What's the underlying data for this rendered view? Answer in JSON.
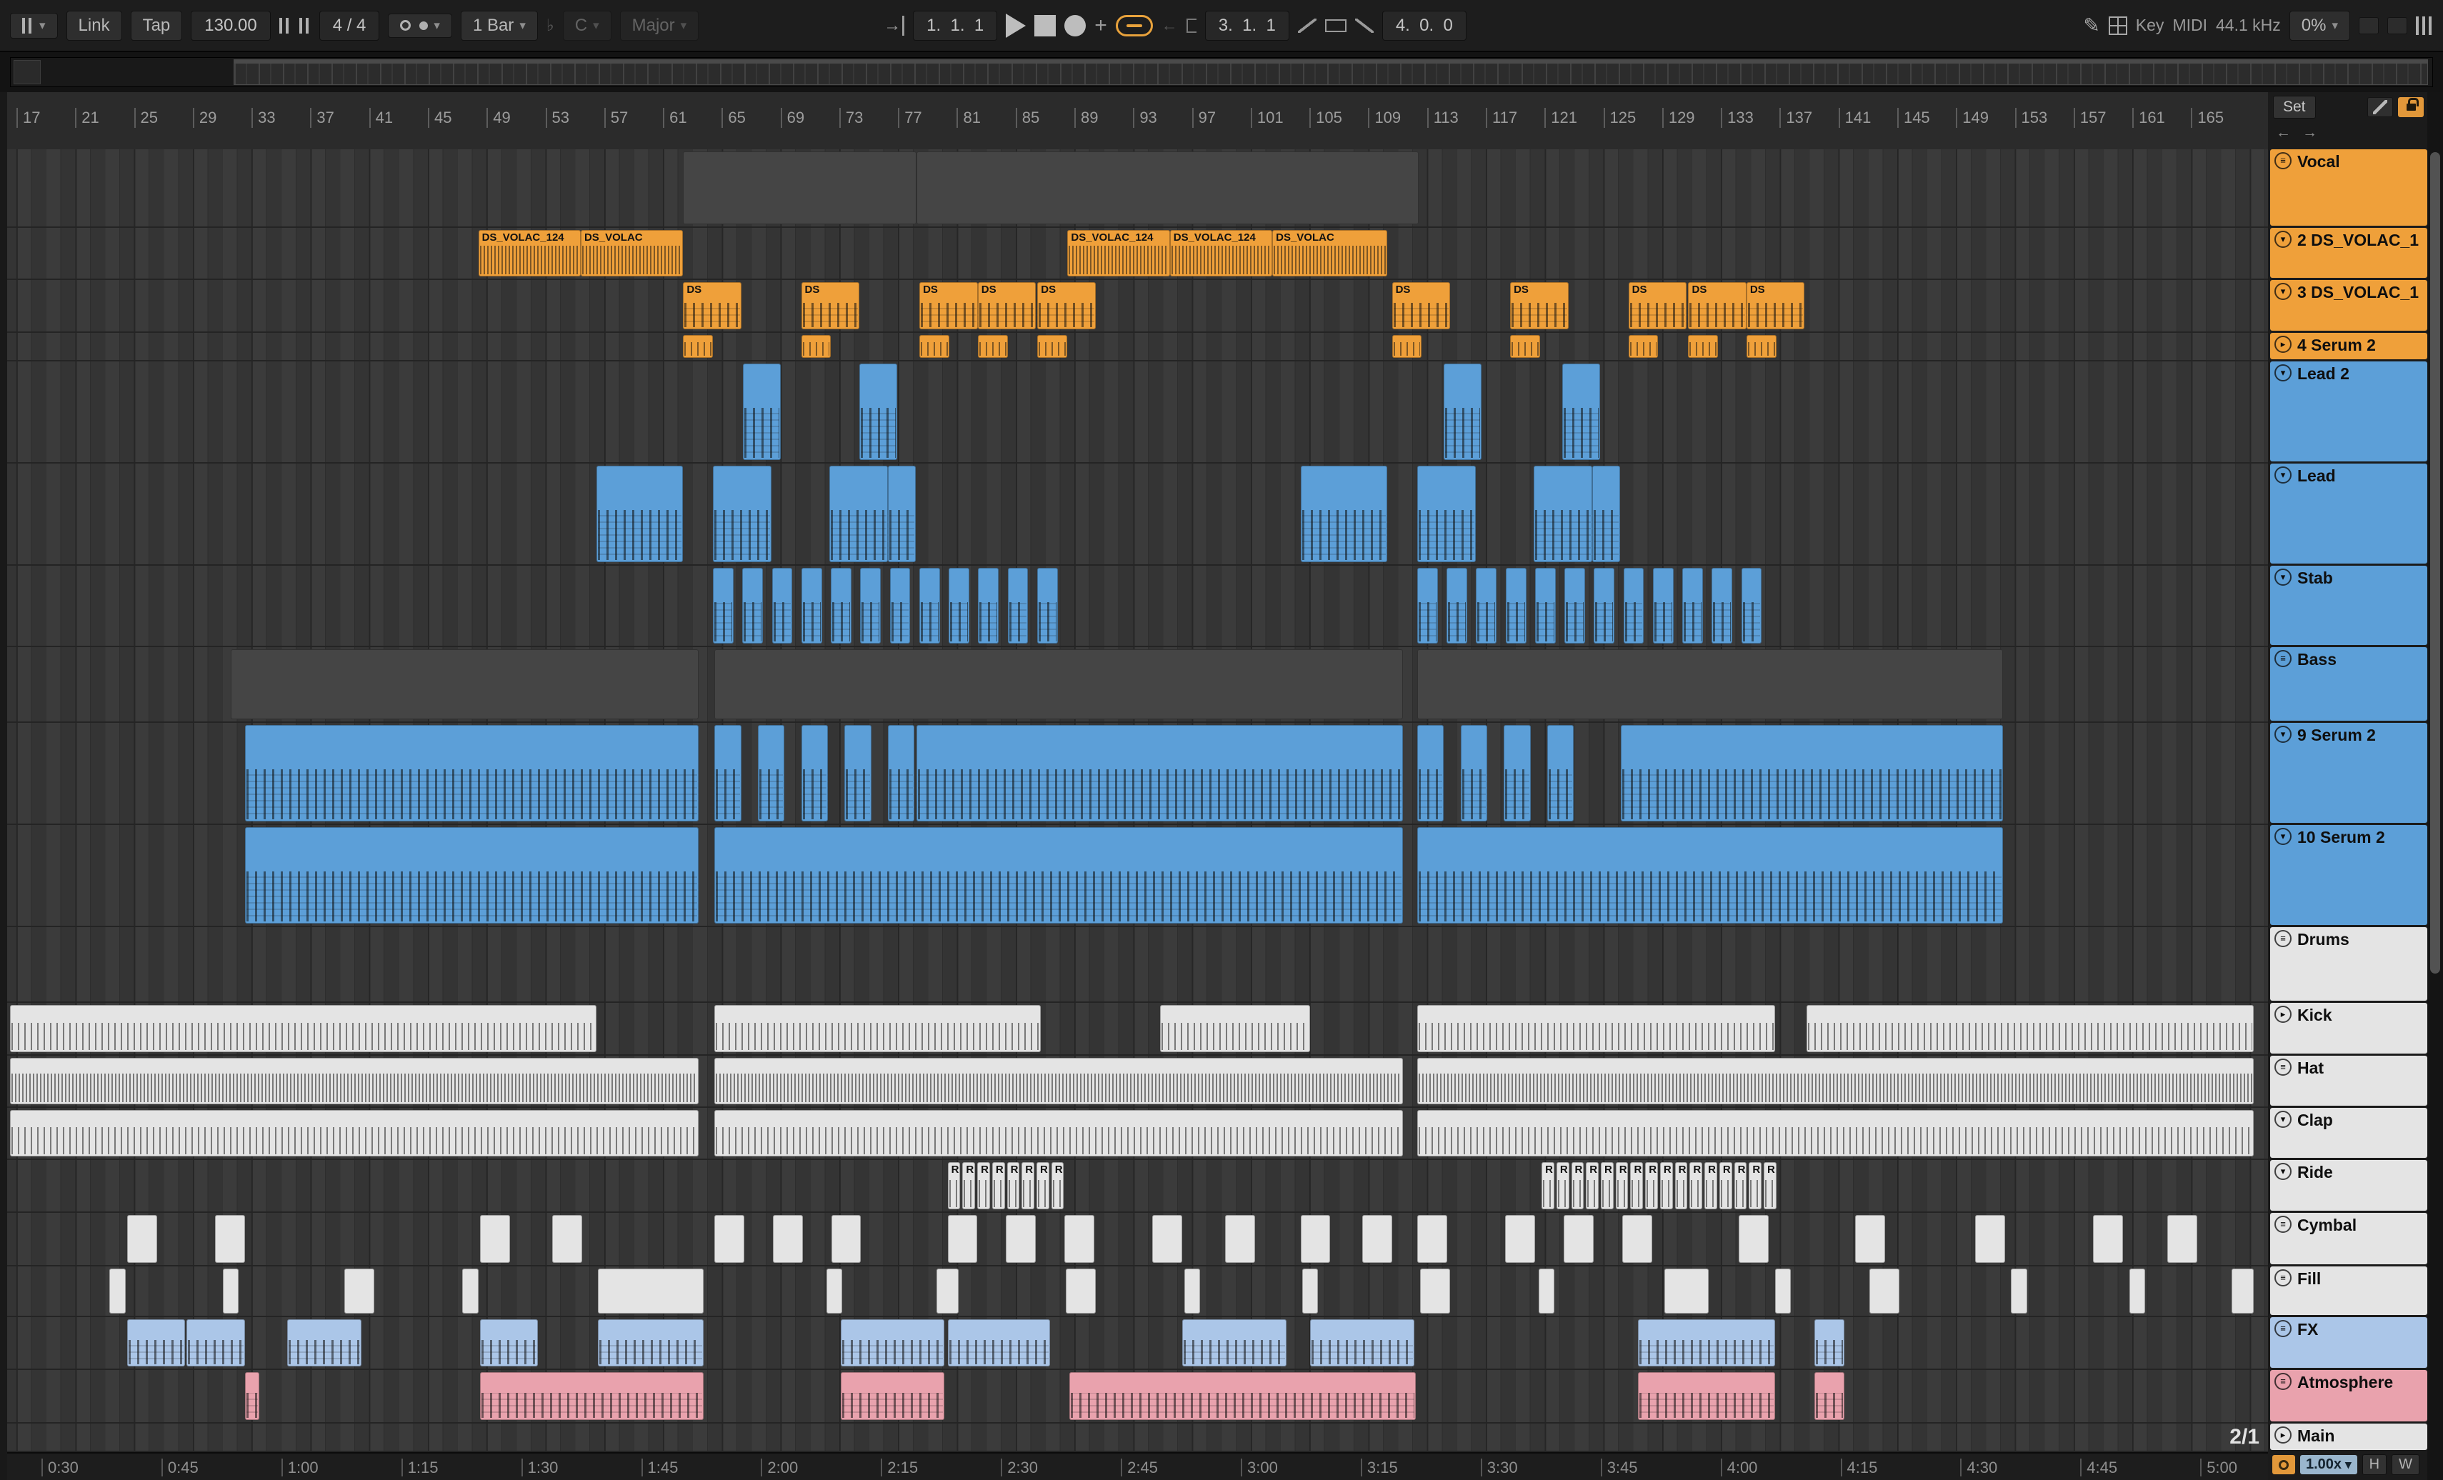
{
  "colors": {
    "orange": "#efa03a",
    "blue": "#5c9fd8",
    "white": "#e4e4e4",
    "lightblue": "#abc6e8",
    "pink": "#e9a2ad",
    "gray": "#454545"
  },
  "icons": {
    "caret": "▾",
    "menu": "≡",
    "pencil": "✎",
    "plus": "+",
    "flat": "♭",
    "back": "←",
    "forward": "→",
    "follow": "→"
  },
  "toolbar": {
    "link": "Link",
    "tap": "Tap",
    "tempo": "130.00",
    "sig": "4 / 4",
    "quantize": "1 Bar",
    "root": "C",
    "scale": "Major",
    "position": "1.  1.  1",
    "punch_in": "3.  1.  1",
    "punch_out": "4.  0.  0",
    "key": "Key",
    "midi": "MIDI",
    "rate": "44.1 kHz",
    "cpu": "0%"
  },
  "right_panel": {
    "set": "Set",
    "back": "←",
    "forward": "→"
  },
  "footer": {
    "ratio": "2/1",
    "zoom": "1.00x",
    "h": "H",
    "w": "W"
  },
  "ruler": {
    "bars": [
      17,
      21,
      25,
      29,
      33,
      37,
      41,
      45,
      49,
      53,
      57,
      61,
      65,
      69,
      73,
      77,
      81,
      85,
      89,
      93,
      97,
      101,
      105,
      109,
      113,
      117,
      121,
      125,
      129,
      133,
      137,
      141,
      145,
      149,
      153,
      157,
      161,
      165
    ]
  },
  "time_ruler": {
    "labels": [
      "0:30",
      "0:45",
      "1:00",
      "1:15",
      "1:30",
      "1:45",
      "2:00",
      "2:15",
      "2:30",
      "2:45",
      "3:00",
      "3:15",
      "3:30",
      "3:45",
      "4:00",
      "4:15",
      "4:30",
      "4:45",
      "5:00"
    ]
  },
  "tracks": [
    {
      "name": "Vocal",
      "color": "orange",
      "icon": "≡",
      "h": 110,
      "clips": [
        {
          "s": 29.9,
          "w": 10.31,
          "c": "gray",
          "tex": "plain"
        },
        {
          "s": 40.21,
          "w": 22.23,
          "c": "gray",
          "tex": "plain"
        }
      ]
    },
    {
      "name": "2 DS_VOLAC_1",
      "color": "orange",
      "icon": "▾",
      "h": 73,
      "tex": "dense",
      "clips": [
        {
          "s": 20.84,
          "w": 4.53,
          "label": "DS_VOLAC_124"
        },
        {
          "s": 25.37,
          "w": 4.53,
          "label": "DS_VOLAC"
        },
        {
          "s": 46.9,
          "w": 4.53,
          "label": "DS_VOLAC_124"
        },
        {
          "s": 51.43,
          "w": 4.53,
          "label": "DS_VOLAC_124"
        },
        {
          "s": 55.96,
          "w": 5.09,
          "label": "DS_VOLAC"
        }
      ]
    },
    {
      "name": "3 DS_VOLAC_1",
      "color": "orange",
      "icon": "▾",
      "h": 74,
      "tex": "notes",
      "cw": 2.58,
      "clabel": "DS",
      "clips": [
        {
          "s": 29.9
        },
        {
          "s": 35.12
        },
        {
          "s": 40.35
        },
        {
          "s": 42.93
        },
        {
          "s": 45.57
        },
        {
          "s": 61.25
        },
        {
          "s": 66.48
        },
        {
          "s": 71.71
        },
        {
          "s": 74.36
        },
        {
          "s": 76.93
        }
      ]
    },
    {
      "name": "4 Serum 2",
      "color": "orange",
      "icon": "▸",
      "h": 40,
      "tex": "ticks",
      "cw": 1.32,
      "clips": [
        {
          "s": 29.9
        },
        {
          "s": 35.12
        },
        {
          "s": 40.35
        },
        {
          "s": 42.93
        },
        {
          "s": 45.57
        },
        {
          "s": 61.25
        },
        {
          "s": 66.48
        },
        {
          "s": 71.71
        },
        {
          "s": 74.36
        },
        {
          "s": 76.93
        }
      ]
    },
    {
      "name": "Lead 2",
      "color": "blue",
      "icon": "▾",
      "h": 143,
      "tex": "notes",
      "cw": 1.67,
      "clips": [
        {
          "s": 32.54
        },
        {
          "s": 37.7
        },
        {
          "s": 63.55
        },
        {
          "s": 68.78
        }
      ]
    },
    {
      "name": "Lead",
      "color": "blue",
      "icon": "▾",
      "h": 143,
      "tex": "notes",
      "clips": [
        {
          "s": 26.06,
          "w": 3.83
        },
        {
          "s": 31.22,
          "w": 2.58
        },
        {
          "s": 36.38,
          "w": 2.58
        },
        {
          "s": 38.95,
          "w": 1.25
        },
        {
          "s": 57.21,
          "w": 3.83
        },
        {
          "s": 62.37,
          "w": 2.58
        },
        {
          "s": 67.53,
          "w": 2.58
        },
        {
          "s": 70.1,
          "w": 1.25
        }
      ]
    },
    {
      "name": "Stab",
      "color": "blue",
      "icon": "▾",
      "h": 114,
      "tex": "notes",
      "cw": 0.91,
      "clips": [
        {
          "s": 31.22,
          "n": 12,
          "step": 1.303
        },
        {
          "s": 62.37,
          "n": 12,
          "step": 1.303
        }
      ]
    },
    {
      "name": "Bass",
      "color": "blue",
      "icon": "≡",
      "h": 106,
      "tex": "plain",
      "clips": [
        {
          "s": 9.9,
          "w": 20.7,
          "c": "gray"
        },
        {
          "s": 31.29,
          "w": 30.45,
          "c": "gray"
        },
        {
          "s": 62.37,
          "w": 25.92,
          "c": "gray"
        }
      ]
    },
    {
      "name": "9 Serum 2",
      "color": "blue",
      "icon": "▾",
      "h": 143,
      "tex": "notes",
      "clips": [
        {
          "s": 10.52,
          "w": 20.07
        },
        {
          "s": 31.29,
          "w": 1.18,
          "n": 5,
          "step": 1.916
        },
        {
          "s": 40.21,
          "w": 21.53
        },
        {
          "s": 62.37,
          "w": 1.18,
          "n": 4,
          "step": 1.916
        },
        {
          "s": 71.36,
          "w": 16.93
        }
      ]
    },
    {
      "name": "10 Serum 2",
      "color": "blue",
      "icon": "▾",
      "h": 143,
      "tex": "notes",
      "clips": [
        {
          "s": 10.52,
          "w": 20.07
        },
        {
          "s": 31.29,
          "w": 30.45
        },
        {
          "s": 62.37,
          "w": 25.92
        }
      ]
    },
    {
      "name": "Drums",
      "color": "white",
      "icon": "≡",
      "h": 106,
      "clips": []
    },
    {
      "name": "Kick",
      "color": "white",
      "icon": "▸",
      "h": 74,
      "tex": "ticks",
      "clips": [
        {
          "s": 0.14,
          "w": 25.92
        },
        {
          "s": 31.29,
          "w": 14.43
        },
        {
          "s": 51.01,
          "w": 6.62
        },
        {
          "s": 62.37,
          "w": 15.82
        },
        {
          "s": 79.58,
          "w": 19.79
        }
      ]
    },
    {
      "name": "Hat",
      "color": "white",
      "icon": "≡",
      "h": 73,
      "tex": "dense",
      "clips": [
        {
          "s": 0.14,
          "w": 30.45
        },
        {
          "s": 31.29,
          "w": 30.45
        },
        {
          "s": 62.37,
          "w": 37.0
        }
      ]
    },
    {
      "name": "Clap",
      "color": "white",
      "icon": "▾",
      "h": 73,
      "tex": "ticks",
      "clips": [
        {
          "s": 0.14,
          "w": 30.45
        },
        {
          "s": 31.29,
          "w": 30.45
        },
        {
          "s": 62.37,
          "w": 37.0
        }
      ]
    },
    {
      "name": "Ride",
      "color": "white",
      "icon": "▾",
      "h": 74,
      "tex": "ticks",
      "cw": 0.56,
      "clabel": "R",
      "clips": [
        {
          "s": 41.6,
          "n": 8,
          "step": 0.655
        },
        {
          "s": 67.87,
          "n": 16,
          "step": 0.655
        }
      ]
    },
    {
      "name": "Cymbal",
      "color": "white",
      "icon": "≡",
      "h": 75,
      "tex": "plain",
      "cw": 1.32,
      "clips": [
        {
          "s": 5.3
        },
        {
          "s": 9.2
        },
        {
          "s": 20.91
        },
        {
          "s": 24.11
        },
        {
          "s": 31.29
        },
        {
          "s": 33.87
        },
        {
          "s": 36.45
        },
        {
          "s": 41.6
        },
        {
          "s": 44.18
        },
        {
          "s": 46.76
        },
        {
          "s": 50.66
        },
        {
          "s": 53.87
        },
        {
          "s": 57.21
        },
        {
          "s": 59.93
        },
        {
          "s": 62.37
        },
        {
          "s": 66.27
        },
        {
          "s": 68.85
        },
        {
          "s": 71.43
        },
        {
          "s": 76.59
        },
        {
          "s": 81.74
        },
        {
          "s": 87.04
        },
        {
          "s": 92.26
        },
        {
          "s": 95.54
        }
      ]
    },
    {
      "name": "Fill",
      "color": "white",
      "icon": "≡",
      "h": 71,
      "tex": "plain",
      "clips": [
        {
          "s": 4.53,
          "w": 0.7
        },
        {
          "s": 9.55,
          "w": 0.7
        },
        {
          "s": 14.91,
          "w": 1.32
        },
        {
          "s": 20.14,
          "w": 0.7
        },
        {
          "s": 26.13,
          "w": 4.67
        },
        {
          "s": 36.24,
          "w": 0.7
        },
        {
          "s": 41.11,
          "w": 0.98
        },
        {
          "s": 46.83,
          "w": 1.32
        },
        {
          "s": 52.06,
          "w": 0.7
        },
        {
          "s": 57.28,
          "w": 0.7
        },
        {
          "s": 62.51,
          "w": 1.32
        },
        {
          "s": 67.74,
          "w": 0.7
        },
        {
          "s": 73.31,
          "w": 1.95
        },
        {
          "s": 78.19,
          "w": 0.7
        },
        {
          "s": 82.37,
          "w": 1.32
        },
        {
          "s": 88.64,
          "w": 0.7
        },
        {
          "s": 93.87,
          "w": 0.7
        },
        {
          "s": 98.4,
          "w": 0.98
        }
      ]
    },
    {
      "name": "FX",
      "color": "lightblue",
      "icon": "≡",
      "h": 74,
      "tex": "notes",
      "clips": [
        {
          "s": 5.3,
          "w": 2.58
        },
        {
          "s": 7.94,
          "w": 2.58
        },
        {
          "s": 12.4,
          "w": 3.28
        },
        {
          "s": 20.91,
          "w": 2.58
        },
        {
          "s": 26.13,
          "w": 4.67
        },
        {
          "s": 36.86,
          "w": 4.6
        },
        {
          "s": 41.6,
          "w": 4.53
        },
        {
          "s": 51.99,
          "w": 4.6
        },
        {
          "s": 57.63,
          "w": 4.6
        },
        {
          "s": 72.13,
          "w": 6.06
        },
        {
          "s": 79.93,
          "w": 1.32
        }
      ]
    },
    {
      "name": "Atmosphere",
      "color": "pink",
      "icon": "≡",
      "h": 75,
      "tex": "notes",
      "clips": [
        {
          "s": 10.52,
          "w": 0.63
        },
        {
          "s": 20.91,
          "w": 9.9
        },
        {
          "s": 36.86,
          "w": 4.6
        },
        {
          "s": 46.97,
          "w": 15.33
        },
        {
          "s": 72.13,
          "w": 6.06
        },
        {
          "s": 79.93,
          "w": 1.32
        }
      ]
    },
    {
      "name": "Main",
      "color": "white",
      "icon": "▸",
      "h": 40,
      "tag": "2/1",
      "clips": []
    }
  ]
}
